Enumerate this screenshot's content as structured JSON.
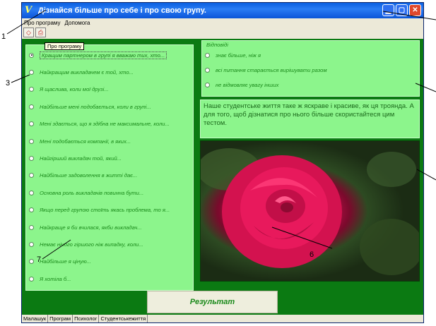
{
  "window": {
    "title": "Дізнайся більше про себе і про свою групу.",
    "icon_letter": "V",
    "controls": [
      "minimize-icon",
      "maximize-icon",
      "close-icon"
    ]
  },
  "menu": {
    "items": [
      "Про програму",
      "Допомога"
    ]
  },
  "toolbar": {
    "buttons": [
      "eraser-icon",
      "print-icon"
    ]
  },
  "tooltip": "Про програму",
  "questions": [
    {
      "label": "Кращим партнером в групі я вважаю тих, хто...",
      "selected": true
    },
    {
      "label": "Найкращим викладачем є той, хто...",
      "selected": false
    },
    {
      "label": "Я щаслива, коли мої друзі...",
      "selected": false
    },
    {
      "label": "Найбільше мені подобається, коли в групі...",
      "selected": false
    },
    {
      "label": "Мені здається, що я здібна не максимальне, коли...",
      "selected": false
    },
    {
      "label": "Мені подобається компанії, в яких...",
      "selected": false
    },
    {
      "label": "Найгірший викладач той, який...",
      "selected": false
    },
    {
      "label": "Найбільше задоволення в житті дає...",
      "selected": false
    },
    {
      "label": "Основна роль викладачів повинна бути...",
      "selected": false
    },
    {
      "label": "Якщо перед групою стоїть якась проблема, то я...",
      "selected": false
    },
    {
      "label": "Найкраще я би вчилася, якби викладач...",
      "selected": false
    },
    {
      "label": "Немає нічого гіршого ніж випадку, коли...",
      "selected": false
    },
    {
      "label": "Найбільше я ціную...",
      "selected": false
    },
    {
      "label": "Я хотіла б...",
      "selected": false
    }
  ],
  "answers": {
    "legend": "Відповіді",
    "items": [
      {
        "label": "знає більше, ніж я",
        "selected": false
      },
      {
        "label": "всі питання старається вирішувати разом",
        "selected": false
      },
      {
        "label": "не відмовляє увагу інших",
        "selected": false
      }
    ]
  },
  "info_text": "Наше студентське життя таке ж яскраве і красиве, як ця троянда. А для того, щоб дізнатися про нього більше скористайтеся цим тестом.",
  "result_button": "Результат",
  "status": [
    "Малашук",
    "Програм",
    "Психолог",
    "Студентськежиття"
  ],
  "callouts": [
    "1",
    "3",
    "6",
    "7"
  ],
  "colors": {
    "panel": "#8cf58c",
    "background": "#0b7a12",
    "text": "#1b8a1b",
    "titlebar": "#0a5fe0"
  }
}
